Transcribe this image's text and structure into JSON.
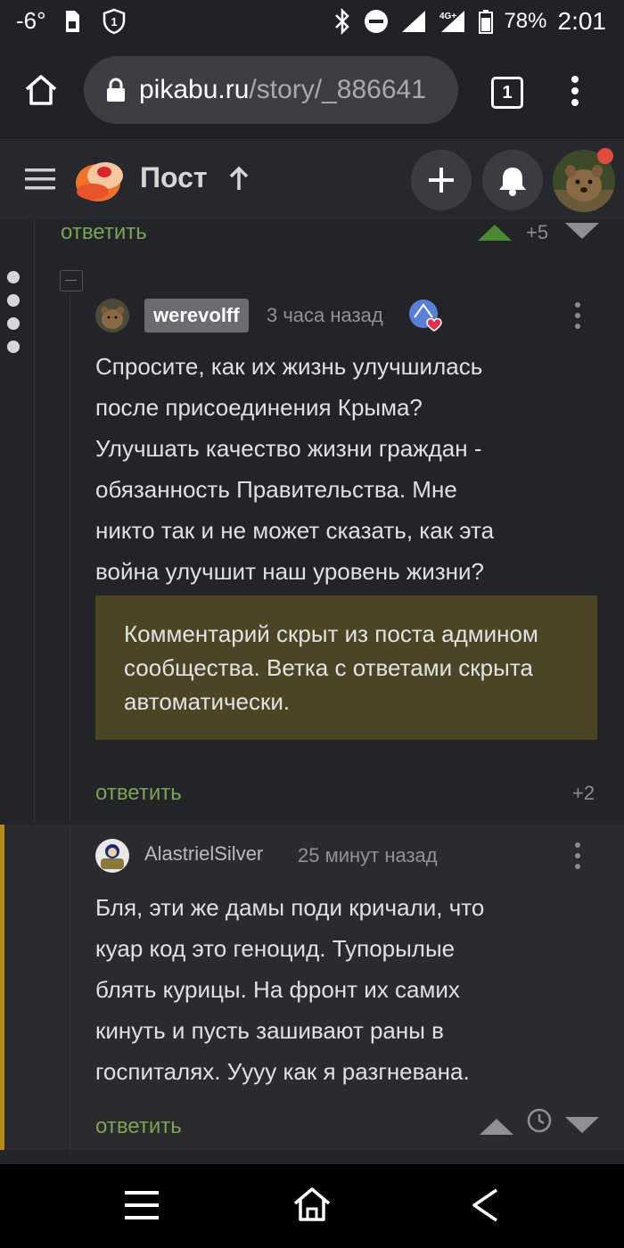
{
  "status_bar": {
    "temperature": "-6°",
    "battery": "78%",
    "time": "2:01",
    "network": "4G+"
  },
  "browser": {
    "url_domain": "pikabu.ru",
    "url_path": "/story/_886641",
    "tab_count": "1"
  },
  "app_header": {
    "title": "Пост"
  },
  "thread": {
    "prev_reply_label": "ответить",
    "prev_score": "+5",
    "comment1": {
      "username": "werevolff",
      "time": "3 часа назад",
      "text_lines": [
        "Спросите, как их жизнь улучшилась",
        "после присоединения Крыма?",
        "Улучшать качество жизни граждан -",
        "обязанность Правительства. Мне",
        "никто так и не может сказать, как эта",
        "война улучшит наш уровень жизни?"
      ],
      "hidden_notice": "Комментарий скрыт из поста админом сообщества. Ветка с ответами скрыта автоматически.",
      "reply_label": "ответить",
      "score": "+2"
    },
    "comment2": {
      "username": "AlastrielSilver",
      "time": "25 минут назад",
      "text_lines": [
        "Бля, эти же дамы поди кричали, что",
        "куар код это геноцид. Тупорылые",
        "блять курицы.  На фронт их самих",
        "кинуть и пусть зашивают раны в",
        "госпиталях. Уууу как я разгневана."
      ],
      "reply_label": "ответить"
    }
  },
  "colors": {
    "background": "#222428",
    "accent_green": "#7aa356",
    "hidden_box": "#4b4526",
    "highlight_bar": "#b58b15"
  },
  "icons": [
    "home-icon",
    "lock-icon",
    "tabs-icon",
    "menu-icon",
    "hamburger-icon",
    "pikabu-logo",
    "arrow-up-icon",
    "plus-icon",
    "bell-icon",
    "kebab-icon",
    "upvote-icon",
    "downvote-icon",
    "clock-icon",
    "nav-menu-icon",
    "nav-home-icon",
    "nav-back-icon"
  ]
}
